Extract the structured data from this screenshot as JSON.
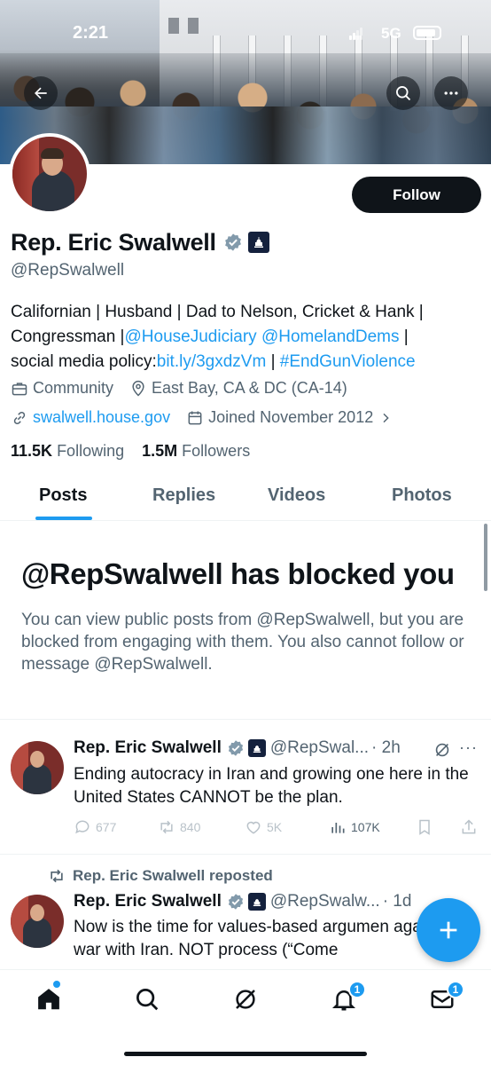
{
  "status_bar": {
    "time": "2:21",
    "network": "5G"
  },
  "profile": {
    "follow_label": "Follow",
    "display_name": "Rep. Eric Swalwell",
    "handle": "@RepSwalwell",
    "bio": {
      "line1": "Californian | Husband | Dad to Nelson, Cricket & Hank |",
      "line2_prefix": "Congressman |",
      "link_judiciary": "@HouseJudiciary",
      "link_homeland": "@HomelandDems",
      "line2_suffix": " |",
      "line3_prefix": "social media policy:",
      "link_policy": "bit.ly/3gxdzVm",
      "line3_mid": " | ",
      "link_hashtag": "#EndGunViolence"
    },
    "category": "Community",
    "location": "East Bay, CA & DC (CA-14)",
    "website": "swalwell.house.gov",
    "joined": "Joined November 2012",
    "following_count": "11.5K",
    "following_label": "Following",
    "followers_count": "1.5M",
    "followers_label": "Followers"
  },
  "tabs": [
    "Posts",
    "Replies",
    "Videos",
    "Photos"
  ],
  "blocked": {
    "title": "@RepSwalwell has blocked you",
    "message": "You can view public posts from @RepSwalwell, but you are blocked from engaging with them. You also cannot follow or message @RepSwalwell."
  },
  "tweets": [
    {
      "name": "Rep. Eric Swalwell",
      "handle": "@RepSwal...",
      "time": "· 2h",
      "text": "Ending autocracy in Iran and growing one here in the United States CANNOT be the plan.",
      "replies": "677",
      "reposts": "840",
      "likes": "5K",
      "views": "107K"
    },
    {
      "repost_label": "Rep. Eric Swalwell reposted",
      "name": "Rep. Eric Swalwell",
      "handle": "@RepSwalw...",
      "time": "· 1d",
      "text": "Now is the time for values-based argumen against war with Iran.  NOT process (“Come"
    }
  ],
  "nav_badges": {
    "notifications": "1",
    "messages": "1"
  },
  "colors": {
    "accent": "#1d9bf0",
    "text": "#0f1419",
    "secondary": "#536471"
  },
  "icons": [
    "back-arrow-icon",
    "search-icon",
    "more-icon",
    "verified-icon",
    "gov-badge-icon",
    "briefcase-icon",
    "location-icon",
    "link-icon",
    "calendar-icon",
    "chevron-right-icon",
    "grok-icon",
    "reply-icon",
    "repost-icon",
    "like-icon",
    "views-icon",
    "bookmark-icon",
    "share-icon",
    "plus-icon",
    "home-icon",
    "notifications-icon",
    "messages-icon"
  ]
}
